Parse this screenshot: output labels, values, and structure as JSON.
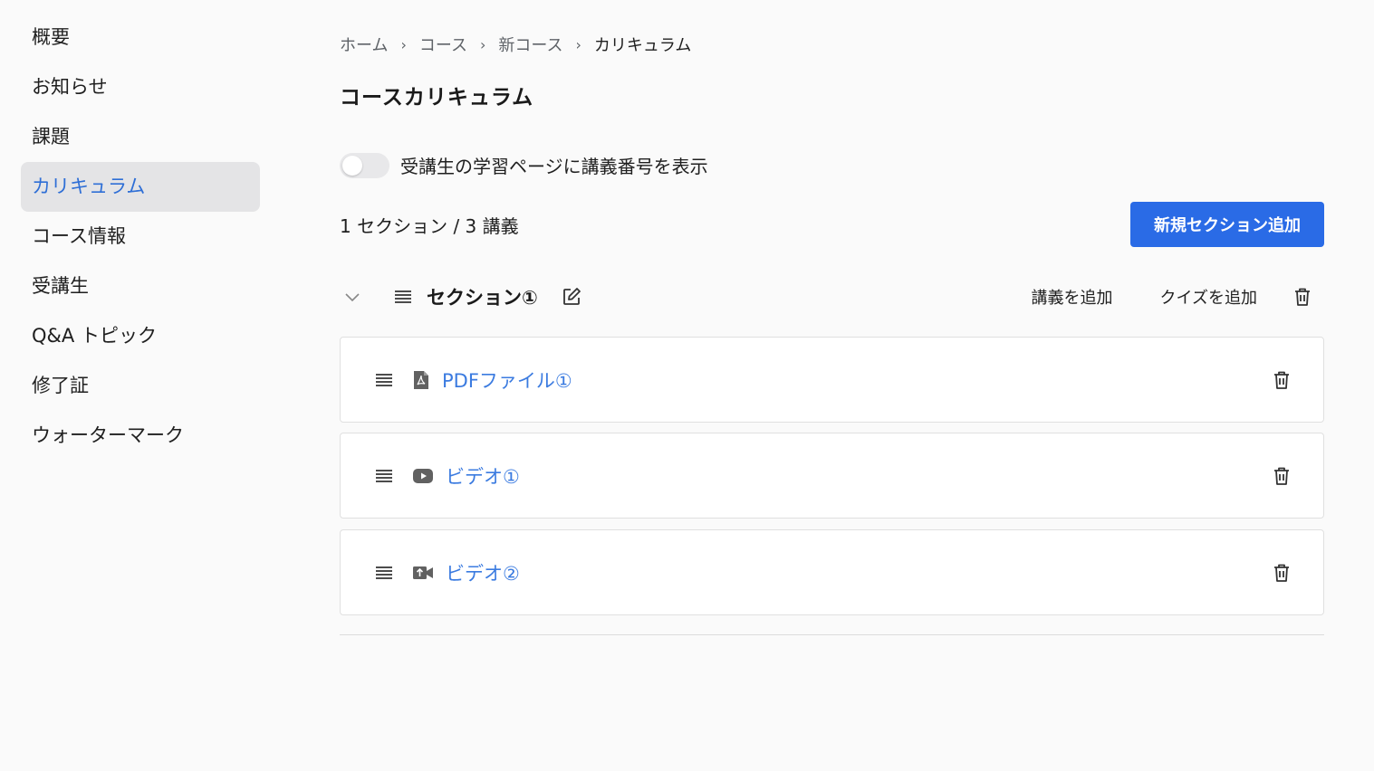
{
  "sidebar": {
    "items": [
      {
        "label": "概要"
      },
      {
        "label": "お知らせ"
      },
      {
        "label": "課題"
      },
      {
        "label": "カリキュラム"
      },
      {
        "label": "コース情報"
      },
      {
        "label": "受講生"
      },
      {
        "label": "Q&A トピック"
      },
      {
        "label": "修了証"
      },
      {
        "label": "ウォーターマーク"
      }
    ],
    "active_index": 3
  },
  "breadcrumb": [
    "ホーム",
    "コース",
    "新コース",
    "カリキュラム"
  ],
  "page_title": "コースカリキュラム",
  "toggle": {
    "label": "受講生の学習ページに講義番号を表示",
    "on": false
  },
  "counts": "1 セクション / 3 講義",
  "add_section_label": "新規セクション追加",
  "section": {
    "title": "セクション①",
    "add_lecture_label": "講義を追加",
    "add_quiz_label": "クイズを追加",
    "icons": [
      "chevron-down-icon",
      "drag-handle-icon",
      "edit-icon",
      "trash-icon"
    ]
  },
  "lectures": [
    {
      "title": "PDFファイル①",
      "icon": "pdf-icon"
    },
    {
      "title": "ビデオ①",
      "icon": "youtube-icon"
    },
    {
      "title": "ビデオ②",
      "icon": "video-camera-icon"
    }
  ],
  "colors": {
    "accent": "#2a6be6",
    "link": "#3b7be0",
    "active_bg": "#e4e4e6",
    "active_text": "#2f6fd6"
  }
}
